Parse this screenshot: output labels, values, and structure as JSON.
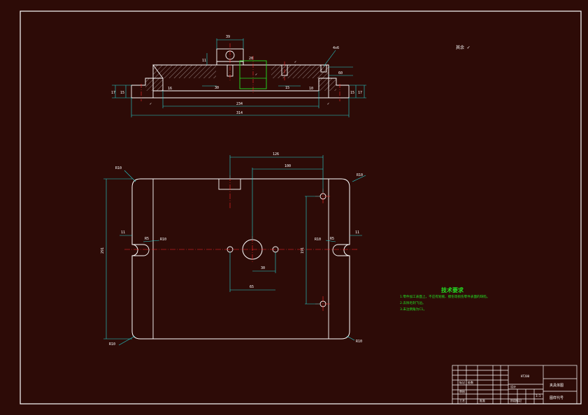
{
  "drawing": {
    "roughness_mark": "其余",
    "tech_title": "技术要求",
    "tech_notes": [
      "1.零件加工表面上，不应有划痕、擦伤等损伤零件表面的缺陷。",
      "2.去除毛刺飞边。",
      "3.未注倒角为C1。"
    ]
  },
  "front_view": {
    "dims": [
      "39",
      "11",
      "20",
      "4x6",
      "30",
      "15",
      "60",
      "17",
      "15",
      "16",
      "234",
      "314",
      "10",
      "15",
      "17"
    ]
  },
  "plan_view": {
    "dims": [
      "126",
      "100",
      "R10",
      "R10",
      "11",
      "11",
      "R5",
      "R5",
      "R10",
      "R10",
      "291",
      "191",
      "30",
      "65",
      "R10",
      "R10"
    ]
  },
  "title_block": {
    "part_name": "夹具体图",
    "drawing_no": "图样代号",
    "material": "HT200",
    "scale": "1:1",
    "labels": [
      "标记",
      "处数",
      "分区",
      "更改文件号",
      "签名",
      "年月日",
      "设计",
      "标准化",
      "审核",
      "工艺",
      "批准",
      "阶段标记",
      "重量",
      "比例",
      "共 张",
      "第 张"
    ]
  }
}
